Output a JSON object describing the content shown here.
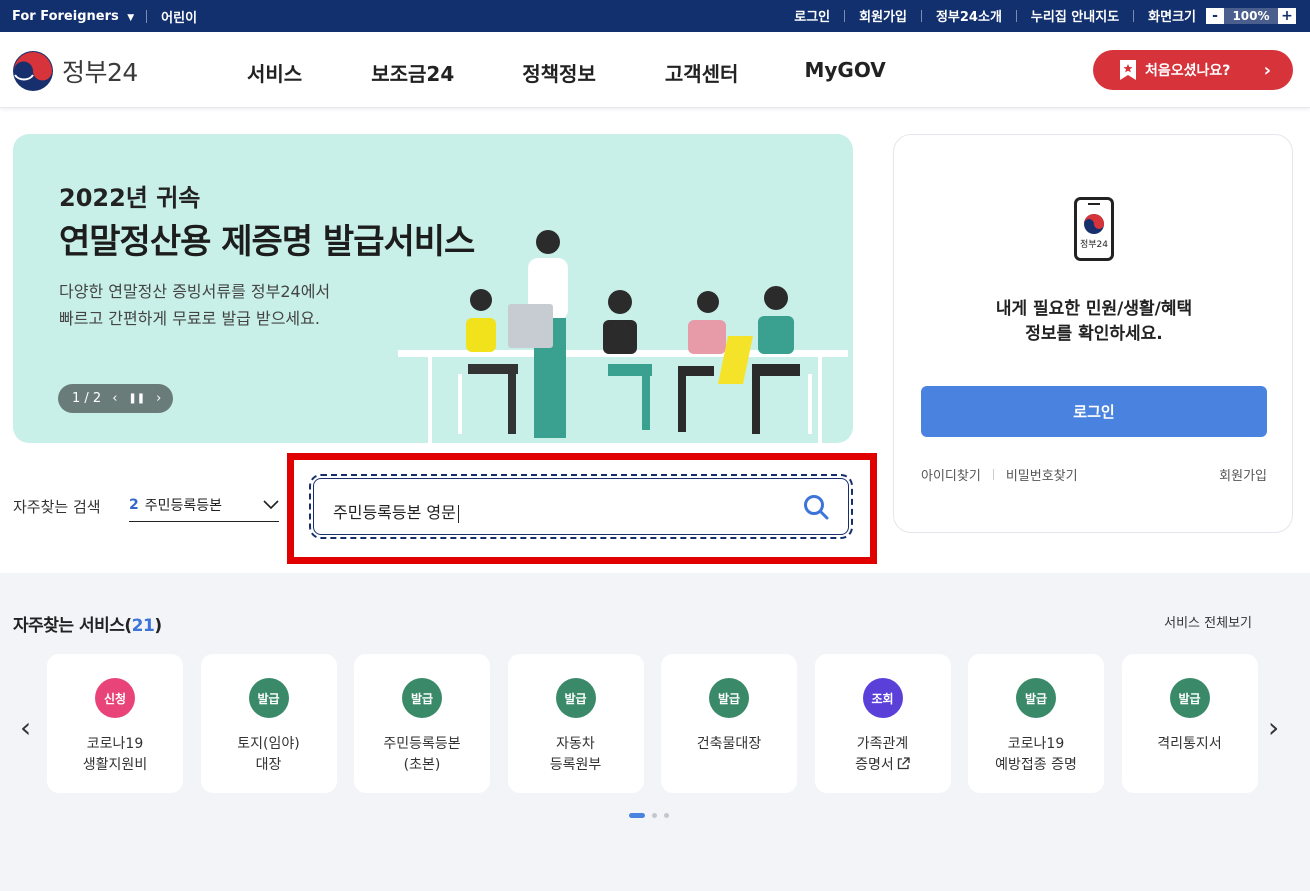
{
  "topbar": {
    "foreign_label": "For Foreigners",
    "kids_label": "어린이",
    "links": [
      "로그인",
      "회원가입",
      "정부24소개",
      "누리집 안내지도"
    ],
    "zoom_label": "화면크기",
    "zoom_minus": "-",
    "zoom_value": "100%",
    "zoom_plus": "+"
  },
  "header": {
    "logo_text": "정부24",
    "nav": [
      "서비스",
      "보조금24",
      "정책정보",
      "고객센터",
      "MyGOV"
    ],
    "cta_label": "처음오셨나요?",
    "cta_color": "#d6333b"
  },
  "banner": {
    "small_title": "2022년 귀속",
    "title": "연말정산용 제증명 발급서비스",
    "desc_line1": "다양한 연말정산 증빙서류를 정부24에서",
    "desc_line2": "빠르고 간편하게 무료로 발급 받으세요.",
    "slide_counter": "1 / 2",
    "bg_color": "#c8f0e8"
  },
  "login_panel": {
    "icon_label": "정부24",
    "message_line1": "내게 필요한 민원/생활/혜택",
    "message_line2": "정보를 확인하세요.",
    "login_button": "로그인",
    "find_id": "아이디찾기",
    "find_pw": "비밀번호찾기",
    "join": "회원가입"
  },
  "search": {
    "frequent_label": "자주찾는 검색",
    "frequent_rank": "2",
    "frequent_value": "주민등록등본",
    "query": "주민등록등본 영문"
  },
  "services": {
    "title": "자주찾는 서비스(",
    "count": "21",
    "title_end": ")",
    "view_all": "서비스 전체보기",
    "cards": [
      {
        "badge": "신청",
        "color": "#e8447a",
        "line1": "코로나19",
        "line2": "생활지원비"
      },
      {
        "badge": "발급",
        "color": "#3a8a6a",
        "line1": "토지(임야)",
        "line2": "대장"
      },
      {
        "badge": "발급",
        "color": "#3a8a6a",
        "line1": "주민등록등본",
        "line2": "(초본)"
      },
      {
        "badge": "발급",
        "color": "#3a8a6a",
        "line1": "자동차",
        "line2": "등록원부"
      },
      {
        "badge": "발급",
        "color": "#3a8a6a",
        "line1": "건축물대장",
        "line2": ""
      },
      {
        "badge": "조회",
        "color": "#5b3fd9",
        "line1": "가족관계",
        "line2": "증명서"
      },
      {
        "badge": "발급",
        "color": "#3a8a6a",
        "line1": "코로나19",
        "line2": "예방접종 증명"
      },
      {
        "badge": "발급",
        "color": "#3a8a6a",
        "line1": "격리통지서",
        "line2": ""
      }
    ]
  }
}
